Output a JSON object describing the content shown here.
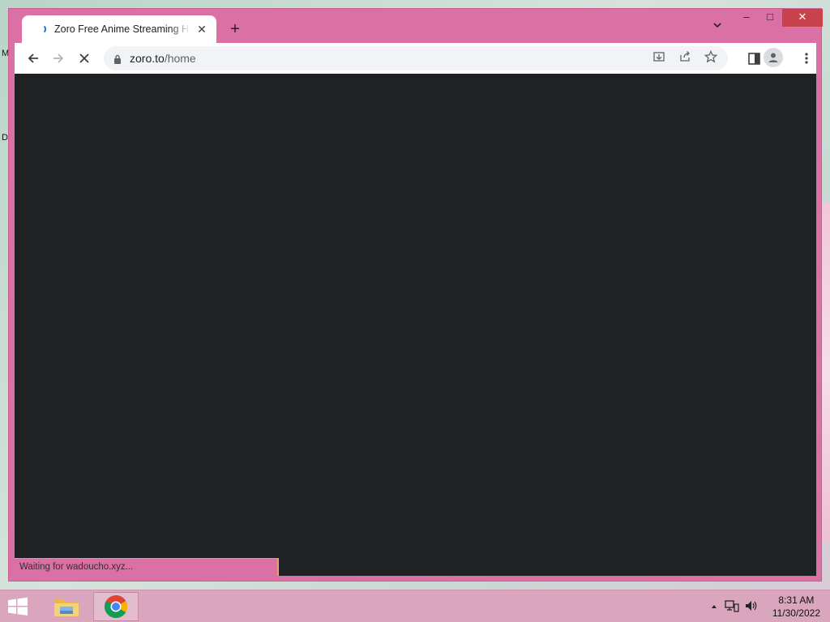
{
  "desktop": {
    "frag_top": "M",
    "frag_mid": "D"
  },
  "browser": {
    "tab": {
      "title": "Zoro Free Anime Streaming Homepage",
      "close": "✕"
    },
    "new_tab": "+",
    "tab_search": "⌄",
    "window_controls": {
      "minimize": "–",
      "maximize": "□",
      "close": "✕"
    },
    "nav": {
      "back": "←",
      "forward": "→",
      "stop": "✕"
    },
    "address": {
      "host": "zoro.to",
      "path": "/home"
    },
    "status_text": "Waiting for wadoucho.xyz..."
  },
  "taskbar": {
    "apps": [
      "File Explorer",
      "Google Chrome"
    ],
    "clock": {
      "time": "8:31 AM",
      "date": "11/30/2022"
    }
  },
  "colors": {
    "window_frame": "#db70a5",
    "page_background": "#202124",
    "taskbar": "#d9a6bd"
  }
}
